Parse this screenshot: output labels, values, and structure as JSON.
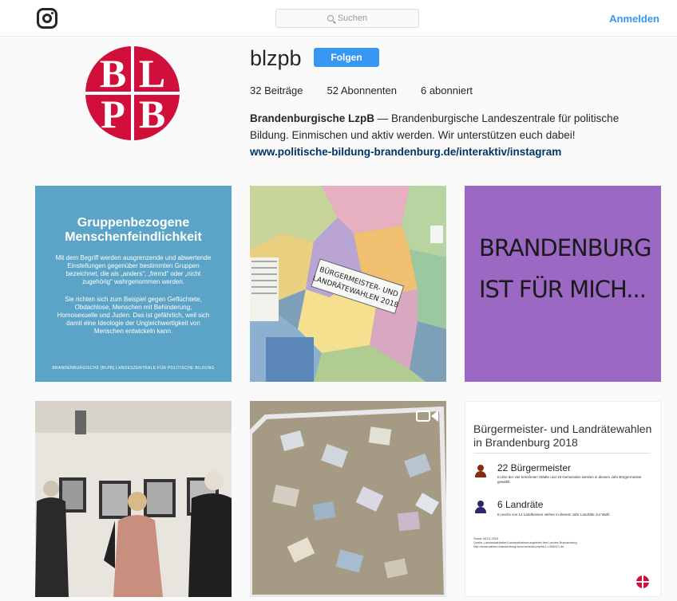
{
  "header": {
    "search_placeholder": "Suchen",
    "login_label": "Anmelden"
  },
  "profile": {
    "avatar_letters": [
      "B",
      "L",
      "P",
      "B"
    ],
    "username": "blzpb",
    "follow_label": "Folgen",
    "stats": {
      "posts": "32 Beiträge",
      "followers": "52 Abonnenten",
      "following": "6 abonniert"
    },
    "bio_name": "Brandenburgische LzpB",
    "bio_text": " — Brandenburgische Landeszentrale für politische Bildung. Einmischen und aktiv werden. Wir unterstützen euch dabei!",
    "bio_link": "www.politische-bildung-brandenburg.de/interaktiv/instagram"
  },
  "posts": {
    "p1": {
      "heading": "Gruppenbezogene Menschenfeindlichkeit",
      "para1": "Mit dem Begriff werden ausgrenzende und abwertende Einstellungen gegenüber bestimmten Gruppen bezeichnet, die als „anders“, „fremd“ oder „nicht zugehörig“ wahrgenommen werden.",
      "para2": "Sie richten sich zum Beispiel gegen Geflüchtete, Obdachlose, Menschen mit Behinderung, Homosexuelle und Juden. Das ist gefährlich, weil sich damit eine Ideologie der Ungleichwertigkeit von Menschen entwickeln kann.",
      "footer": "BRANDENBURGISCHE [BLPB] LANDESZENTRALE FÜR POLITISCHE BILDUNG"
    },
    "p2": {
      "sign_line1": "BÜRGERMEISTER- UND",
      "sign_line2": "LANDRÄTEWAHLEN 2018"
    },
    "p3": {
      "line1": "BRANDENBURG",
      "line2": "IST FÜR MICH..."
    },
    "p6": {
      "title": "Bürgermeister- und Landrätewahlen in Brandenburg 2018",
      "item1_big": "22 Bürgermeister",
      "item1_small": "In drei der vier kreisfreien Städte und 19 Gemeinden werden in diesem Jahr Bürgermeister gewählt.",
      "item2_big": "6 Landräte",
      "item2_small": "In sechs von 14 Landkreisen stehen in diesem Jahr Landräte zur Wahl.",
      "src1": "Stand: 08.01.2018",
      "src2": "Quelle: Landeswahlleiter/Landesabstimmungsleiter des Landes Brandenburg",
      "src3": "http://www.wahlen.brandenburg.de/cms/detail.php/bb1.c.556471.de"
    }
  },
  "colors": {
    "accent": "#3897f0",
    "brand_red": "#d0103a",
    "link": "#003569"
  }
}
